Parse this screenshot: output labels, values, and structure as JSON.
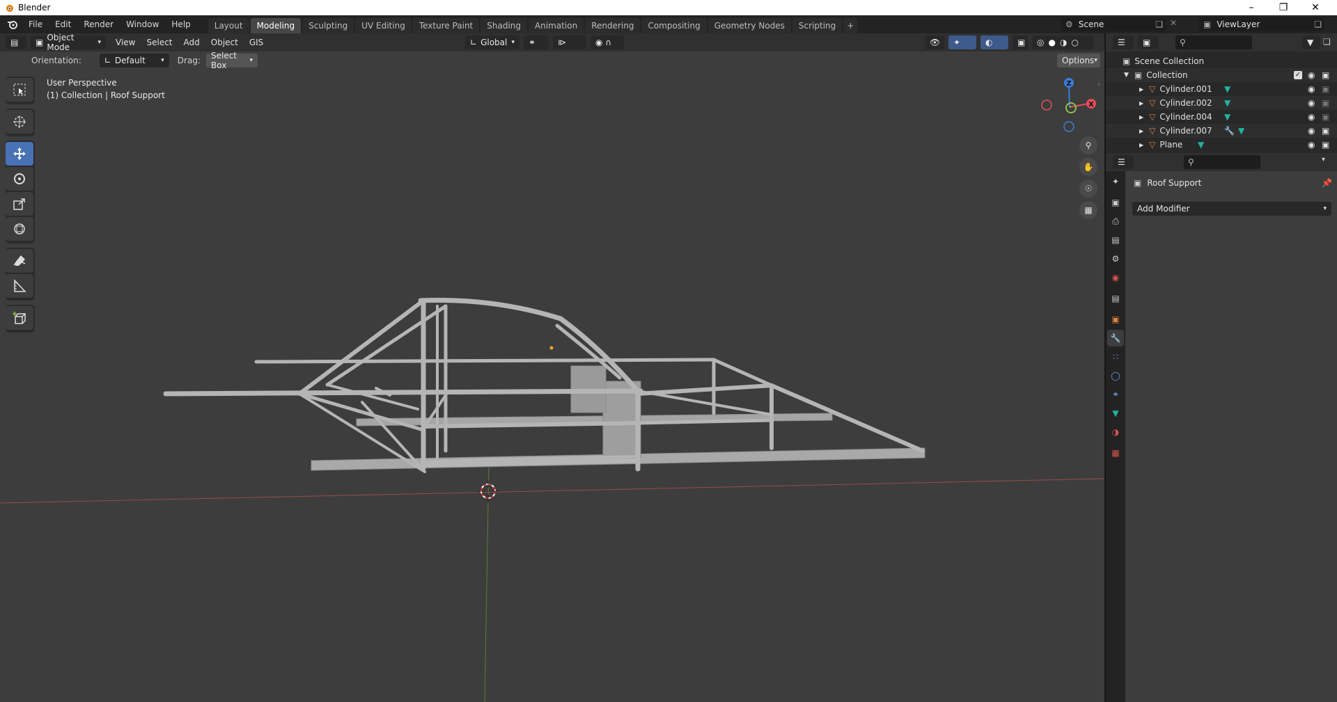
{
  "window": {
    "title": "Blender"
  },
  "menu": {
    "items": [
      "File",
      "Edit",
      "Render",
      "Window",
      "Help"
    ]
  },
  "workspaces": [
    "Layout",
    "Modeling",
    "Sculpting",
    "UV Editing",
    "Texture Paint",
    "Shading",
    "Animation",
    "Rendering",
    "Compositing",
    "Geometry Nodes",
    "Scripting"
  ],
  "active_workspace": "Modeling",
  "scene": {
    "name": "Scene",
    "view_layer": "ViewLayer"
  },
  "viewport": {
    "mode": "Object Mode",
    "menus": [
      "View",
      "Select",
      "Add",
      "Object",
      "GIS"
    ],
    "transform_orientation": "Global",
    "orientation_label": "Orientation:",
    "orientation_value": "Default",
    "drag_label": "Drag:",
    "drag_value": "Select Box",
    "options_label": "Options",
    "overlay_line1": "User Perspective",
    "overlay_line2": "(1) Collection | Roof Support",
    "gizmo": {
      "z": "Z",
      "x": "X"
    }
  },
  "outliner": {
    "root": "Scene Collection",
    "collection": "Collection",
    "objects": [
      "Cylinder.001",
      "Cylinder.002",
      "Cylinder.004",
      "Cylinder.007",
      "Plane"
    ]
  },
  "properties": {
    "object_name": "Roof Support",
    "add_modifier": "Add Modifier"
  },
  "colors": {
    "accent": "#4772b3",
    "x_axis": "#e34d5a",
    "y_axis": "#8bc34a",
    "z_axis": "#3b7ddb",
    "mesh_icon": "#20b4a0",
    "object_icon": "#e3833b"
  }
}
